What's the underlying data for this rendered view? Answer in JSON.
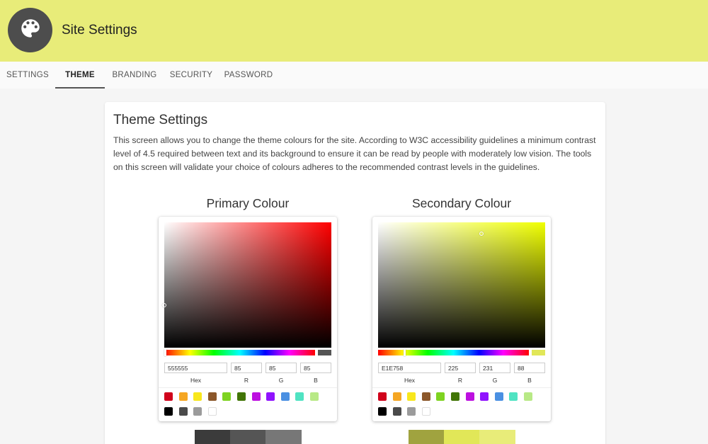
{
  "header": {
    "title": "Site Settings",
    "icon": "palette-icon"
  },
  "tabs": [
    {
      "label": "SETTINGS"
    },
    {
      "label": "THEME"
    },
    {
      "label": "BRANDING"
    },
    {
      "label": "SECURITY"
    },
    {
      "label": "PASSWORD"
    }
  ],
  "active_tab": "THEME",
  "card": {
    "title": "Theme Settings",
    "description": "This screen allows you to change the theme colours for the site. According to W3C accessibility guidelines a minimum contrast level of 4.5 required between text and its background to ensure it can be read by people with moderately low vision. The tools on this screen will validate your choice of colours adheres to the recommended contrast levels in the guidelines."
  },
  "primary": {
    "heading": "Primary Colour",
    "hue_color": "#ff0000",
    "current_color": "#555555",
    "hex": "555555",
    "r": "85",
    "g": "85",
    "b": "85",
    "palette": [
      "#3b3b3b",
      "#555555",
      "#777777"
    ]
  },
  "secondary": {
    "heading": "Secondary Colour",
    "hue_color": "#f0ff00",
    "current_color": "#e1e758",
    "hex": "E1E758",
    "r": "225",
    "g": "231",
    "b": "88",
    "palette": [
      "#a0a33f",
      "#e1e758",
      "#e8ec79"
    ]
  },
  "labels": {
    "hex": "Hex",
    "r": "R",
    "g": "G",
    "b": "B"
  },
  "preset_colors": [
    "#d0021b",
    "#f5a623",
    "#f8e71c",
    "#8b572a",
    "#7ed321",
    "#417505",
    "#bd10e0",
    "#9013fe",
    "#4a90e2",
    "#50e3c2",
    "#b8e986",
    "#000000",
    "#4a4a4a",
    "#9b9b9b",
    "#ffffff"
  ],
  "theme_colors": {
    "header_bg": "#e8ec79",
    "avatar_bg": "#4d4d4d"
  }
}
